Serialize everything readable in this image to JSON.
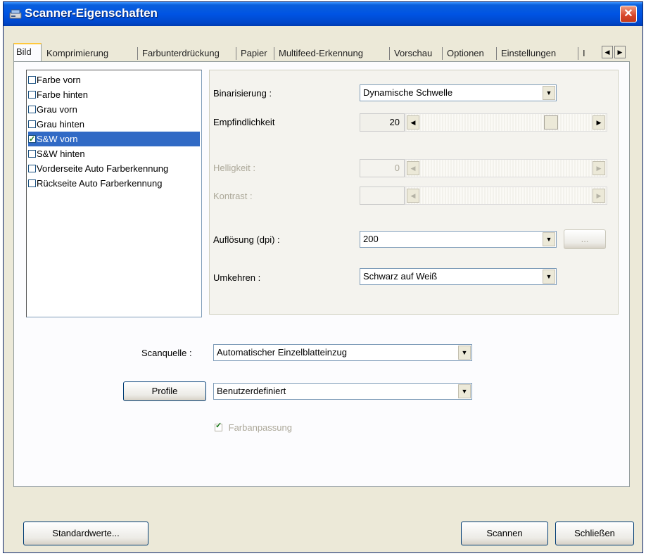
{
  "window": {
    "title": "Scanner-Eigenschaften",
    "close_glyph": "✕"
  },
  "tabs": [
    {
      "label": "Bild",
      "active": true
    },
    {
      "label": "Komprimierung"
    },
    {
      "label": "Farbunterdrückung"
    },
    {
      "label": "Papier"
    },
    {
      "label": "Multifeed-Erkennung"
    },
    {
      "label": "Vorschau"
    },
    {
      "label": "Optionen"
    },
    {
      "label": "Einstellungen"
    },
    {
      "label": "I"
    }
  ],
  "tab_scroll": {
    "left_glyph": "◀",
    "right_glyph": "▶"
  },
  "image_list": {
    "items": [
      {
        "label": "Farbe vorn",
        "checked": false,
        "selected": false
      },
      {
        "label": "Farbe hinten",
        "checked": false,
        "selected": false
      },
      {
        "label": "Grau vorn",
        "checked": false,
        "selected": false
      },
      {
        "label": "Grau hinten",
        "checked": false,
        "selected": false
      },
      {
        "label": "S&W vorn",
        "checked": true,
        "selected": true
      },
      {
        "label": "S&W hinten",
        "checked": false,
        "selected": false
      },
      {
        "label": "Vorderseite Auto Farberkennung",
        "checked": false,
        "selected": false
      },
      {
        "label": "Rückseite Auto Farberkennung",
        "checked": false,
        "selected": false
      }
    ]
  },
  "settings": {
    "binarization_label": "Binarisierung :",
    "binarization_value": "Dynamische Schwelle",
    "sensitivity_label": "Empfindlichkeit",
    "sensitivity_value": "20",
    "sensitivity_fraction": 0.78,
    "brightness_label": "Helligkeit :",
    "brightness_value": "0",
    "contrast_label": "Kontrast :",
    "contrast_value": "",
    "resolution_label": "Auflösung (dpi) :",
    "resolution_value": "200",
    "resolution_more": "...",
    "invert_label": "Umkehren :",
    "invert_value": "Schwarz auf Weiß"
  },
  "scan": {
    "source_label": "Scanquelle :",
    "source_value": "Automatischer Einzelblatteinzug",
    "profile_button": "Profile",
    "profile_value": "Benutzerdefiniert",
    "color_match_label": "Farbanpassung",
    "color_match_checked": true
  },
  "footer": {
    "defaults_button": "Standardwerte...",
    "scan_button": "Scannen",
    "close_button": "Schließen"
  },
  "glyphs": {
    "dropdown": "▼",
    "left": "◀",
    "right": "▶"
  }
}
